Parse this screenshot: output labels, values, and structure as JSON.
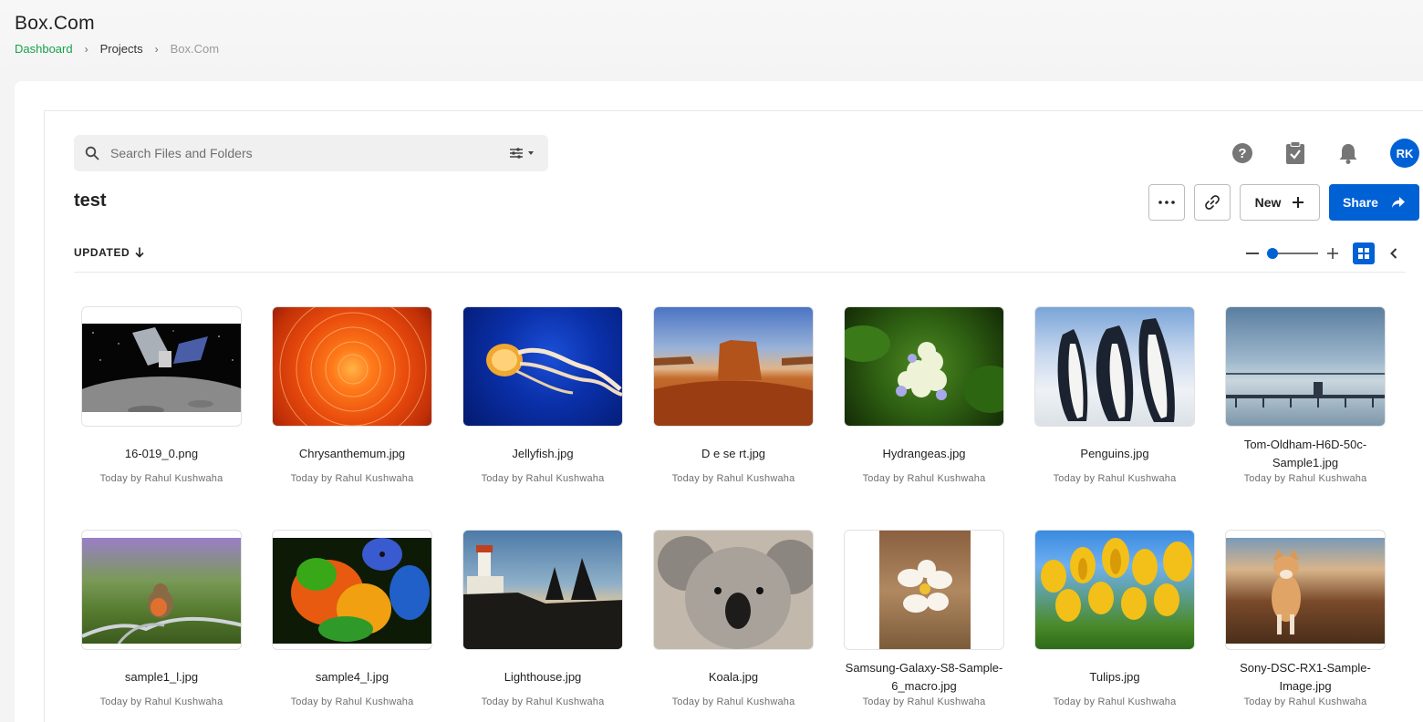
{
  "page": {
    "title": "Box.Com"
  },
  "breadcrumb": {
    "dashboard": "Dashboard",
    "projects": "Projects",
    "current": "Box.Com"
  },
  "search": {
    "placeholder": "Search Files and Folders"
  },
  "user": {
    "initials": "RK"
  },
  "folder": {
    "title": "test"
  },
  "toolbar": {
    "new_label": "New",
    "share_label": "Share"
  },
  "sort": {
    "label": "UPDATED"
  },
  "colors": {
    "accent": "#0061d5",
    "breadcrumb_link": "#16a34a"
  },
  "files": [
    {
      "name": "16-019_0.png",
      "meta": "Today by Rahul Kushwaha",
      "thumb": "space"
    },
    {
      "name": "Chrysanthemum.jpg",
      "meta": "Today by Rahul Kushwaha",
      "thumb": "flower-orange"
    },
    {
      "name": "Jellyfish.jpg",
      "meta": "Today by Rahul Kushwaha",
      "thumb": "jellyfish"
    },
    {
      "name": "D e se rt.jpg",
      "meta": "Today by Rahul Kushwaha",
      "thumb": "desert"
    },
    {
      "name": "Hydrangeas.jpg",
      "meta": "Today by Rahul Kushwaha",
      "thumb": "hydrangea"
    },
    {
      "name": "Penguins.jpg",
      "meta": "Today by Rahul Kushwaha",
      "thumb": "penguins"
    },
    {
      "name": "Tom-Oldham-H6D-50c-Sample1.jpg",
      "meta": "Today by Rahul Kushwaha",
      "thumb": "pier"
    },
    {
      "name": "sample1_l.jpg",
      "meta": "Today by Rahul Kushwaha",
      "thumb": "robin"
    },
    {
      "name": "sample4_l.jpg",
      "meta": "Today by Rahul Kushwaha",
      "thumb": "parrot"
    },
    {
      "name": "Lighthouse.jpg",
      "meta": "Today by Rahul Kushwaha",
      "thumb": "lighthouse"
    },
    {
      "name": "Koala.jpg",
      "meta": "Today by Rahul Kushwaha",
      "thumb": "koala"
    },
    {
      "name": "Samsung-Galaxy-S8-Sample-6_macro.jpg",
      "meta": "Today by Rahul Kushwaha",
      "thumb": "plumeria"
    },
    {
      "name": "Tulips.jpg",
      "meta": "Today by Rahul Kushwaha",
      "thumb": "tulips"
    },
    {
      "name": "Sony-DSC-RX1-Sample-Image.jpg",
      "meta": "Today by Rahul Kushwaha",
      "thumb": "dog"
    }
  ]
}
